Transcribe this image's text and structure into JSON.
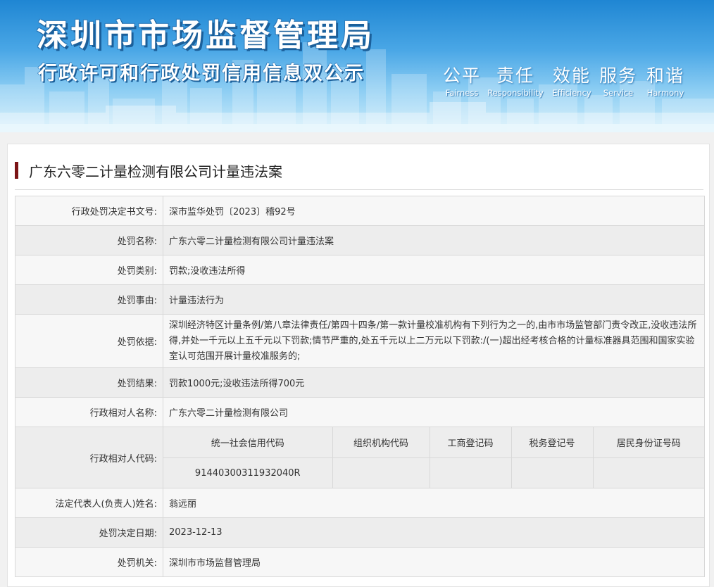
{
  "header": {
    "title": "深圳市市场监督管理局",
    "subtitle": "行政许可和行政处罚信用信息双公示",
    "slogans": [
      {
        "cn": "公平",
        "en": "Fairness"
      },
      {
        "cn": "责任",
        "en": "Responsibility"
      },
      {
        "cn": "效能",
        "en": "Efficiency"
      },
      {
        "cn": "服务",
        "en": "Service"
      },
      {
        "cn": "和谐",
        "en": "Harmony"
      }
    ]
  },
  "case": {
    "title": "广东六零二计量检测有限公司计量违法案",
    "fields": {
      "doc_no": {
        "label": "行政处罚决定书文号:",
        "value": "深市监华处罚〔2023〕稽92号"
      },
      "name": {
        "label": "处罚名称:",
        "value": "广东六零二计量检测有限公司计量违法案"
      },
      "category": {
        "label": "处罚类别:",
        "value": "罚款;没收违法所得"
      },
      "cause": {
        "label": "处罚事由:",
        "value": "计量违法行为"
      },
      "basis": {
        "label": "处罚依据:",
        "value": "深圳经济特区计量条例/第八章法律责任/第四十四条/第一款计量校准机构有下列行为之一的,由市市场监管部门责令改正,没收违法所得,并处一千元以上五千元以下罚款;情节严重的,处五千元以上二万元以下罚款:/(一)超出经考核合格的计量标准器具范围和国家实验室认可范围开展计量校准服务的;"
      },
      "result": {
        "label": "处罚结果:",
        "value": "罚款1000元;没收违法所得700元"
      },
      "party_name": {
        "label": "行政相对人名称:",
        "value": "广东六零二计量检测有限公司"
      },
      "party_code": {
        "label": "行政相对人代码:",
        "headers": [
          "统一社会信用代码",
          "组织机构代码",
          "工商登记码",
          "税务登记号",
          "居民身份证号码"
        ],
        "values": [
          "91440300311932040R",
          "",
          "",
          "",
          ""
        ]
      },
      "legal_rep": {
        "label": "法定代表人(负责人)姓名:",
        "value": "翁远丽"
      },
      "decision_date": {
        "label": "处罚决定日期:",
        "value": "2023-12-13"
      },
      "authority": {
        "label": "处罚机关:",
        "value": "深圳市市场监督管理局"
      }
    }
  }
}
